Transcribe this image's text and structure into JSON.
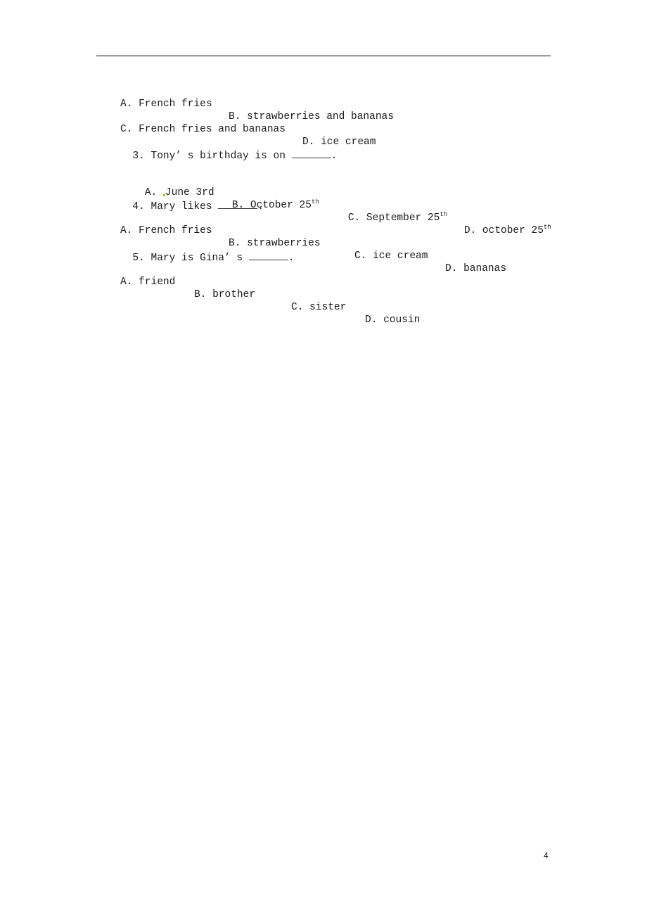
{
  "questions": {
    "q2_options": {
      "a": "A. French fries",
      "b": "B. strawberries and bananas",
      "c": "C. French fries and bananas",
      "d": "D. ice cream"
    },
    "q3": {
      "stem": "3. Tony’ s birthday is on ",
      "end": ".",
      "options": {
        "a_label": "A. ",
        "a_text": "June 3rd",
        "b_text": "B. October 25",
        "b_sup": "th",
        "c_text": "C. September 25",
        "c_sup": "th",
        "d_text": "D. october 25",
        "d_sup": "th"
      }
    },
    "q4": {
      "stem": "4. Mary likes ",
      "end": ".",
      "options": {
        "a": "A. French fries",
        "b": "B. strawberries",
        "c": "C. ice cream",
        "d": "D. bananas"
      }
    },
    "q5": {
      "stem": "5. Mary is Gina’ s ",
      "end": ".",
      "options": {
        "a": "A. friend",
        "b": "B. brother",
        "c": "C. sister",
        "d": "D. cousin"
      }
    }
  },
  "footer": {
    "page_number": "4"
  }
}
